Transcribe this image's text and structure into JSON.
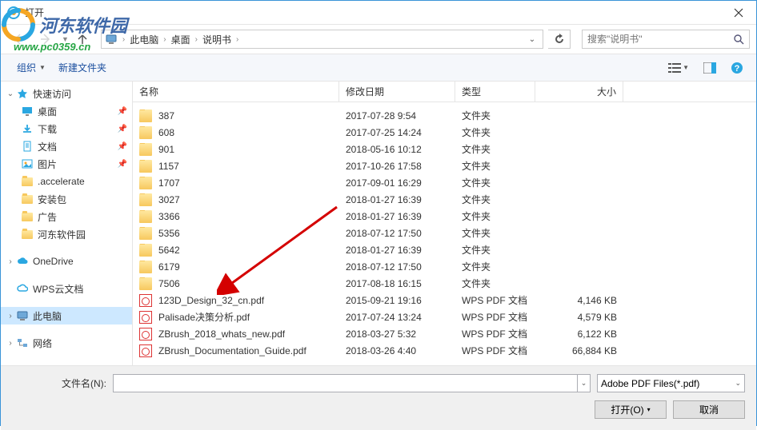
{
  "window": {
    "title": "打开"
  },
  "watermark": {
    "text": "河东软件园",
    "url": "www.pc0359.cn"
  },
  "breadcrumb": {
    "parts": [
      "此电脑",
      "桌面",
      "说明书"
    ]
  },
  "search": {
    "placeholder": "搜索\"说明书\""
  },
  "toolbar": {
    "organize": "组织",
    "newFolder": "新建文件夹"
  },
  "columns": {
    "name": "名称",
    "date": "修改日期",
    "type": "类型",
    "size": "大小"
  },
  "sidebar": {
    "quickAccess": "快速访问",
    "desktop": "桌面",
    "downloads": "下载",
    "documents": "文档",
    "pictures": "图片",
    "accelerate": ".accelerate",
    "installPkg": "安装包",
    "ads": "广告",
    "hdpark": "河东软件园",
    "oneDrive": "OneDrive",
    "wpsCloud": "WPS云文档",
    "thisPC": "此电脑",
    "network": "网络"
  },
  "files": [
    {
      "name": "387",
      "date": "2017-07-28 9:54",
      "type": "文件夹",
      "size": "",
      "kind": "folder"
    },
    {
      "name": "608",
      "date": "2017-07-25 14:24",
      "type": "文件夹",
      "size": "",
      "kind": "folder"
    },
    {
      "name": "901",
      "date": "2018-05-16 10:12",
      "type": "文件夹",
      "size": "",
      "kind": "folder"
    },
    {
      "name": "1157",
      "date": "2017-10-26 17:58",
      "type": "文件夹",
      "size": "",
      "kind": "folder"
    },
    {
      "name": "1707",
      "date": "2017-09-01 16:29",
      "type": "文件夹",
      "size": "",
      "kind": "folder"
    },
    {
      "name": "3027",
      "date": "2018-01-27 16:39",
      "type": "文件夹",
      "size": "",
      "kind": "folder"
    },
    {
      "name": "3366",
      "date": "2018-01-27 16:39",
      "type": "文件夹",
      "size": "",
      "kind": "folder"
    },
    {
      "name": "5356",
      "date": "2018-07-12 17:50",
      "type": "文件夹",
      "size": "",
      "kind": "folder"
    },
    {
      "name": "5642",
      "date": "2018-01-27 16:39",
      "type": "文件夹",
      "size": "",
      "kind": "folder"
    },
    {
      "name": "6179",
      "date": "2018-07-12 17:50",
      "type": "文件夹",
      "size": "",
      "kind": "folder"
    },
    {
      "name": "7506",
      "date": "2017-08-18 16:15",
      "type": "文件夹",
      "size": "",
      "kind": "folder"
    },
    {
      "name": "123D_Design_32_cn.pdf",
      "date": "2015-09-21 19:16",
      "type": "WPS PDF 文档",
      "size": "4,146 KB",
      "kind": "pdf"
    },
    {
      "name": "Palisade决策分析.pdf",
      "date": "2017-07-24 13:24",
      "type": "WPS PDF 文档",
      "size": "4,579 KB",
      "kind": "pdf"
    },
    {
      "name": "ZBrush_2018_whats_new.pdf",
      "date": "2018-03-27 5:32",
      "type": "WPS PDF 文档",
      "size": "6,122 KB",
      "kind": "pdf"
    },
    {
      "name": "ZBrush_Documentation_Guide.pdf",
      "date": "2018-03-26 4:40",
      "type": "WPS PDF 文档",
      "size": "66,884 KB",
      "kind": "pdf"
    }
  ],
  "footer": {
    "filenameLabel": "文件名(N):",
    "filetype": "Adobe PDF Files(*.pdf)",
    "open": "打开(O)",
    "cancel": "取消"
  }
}
